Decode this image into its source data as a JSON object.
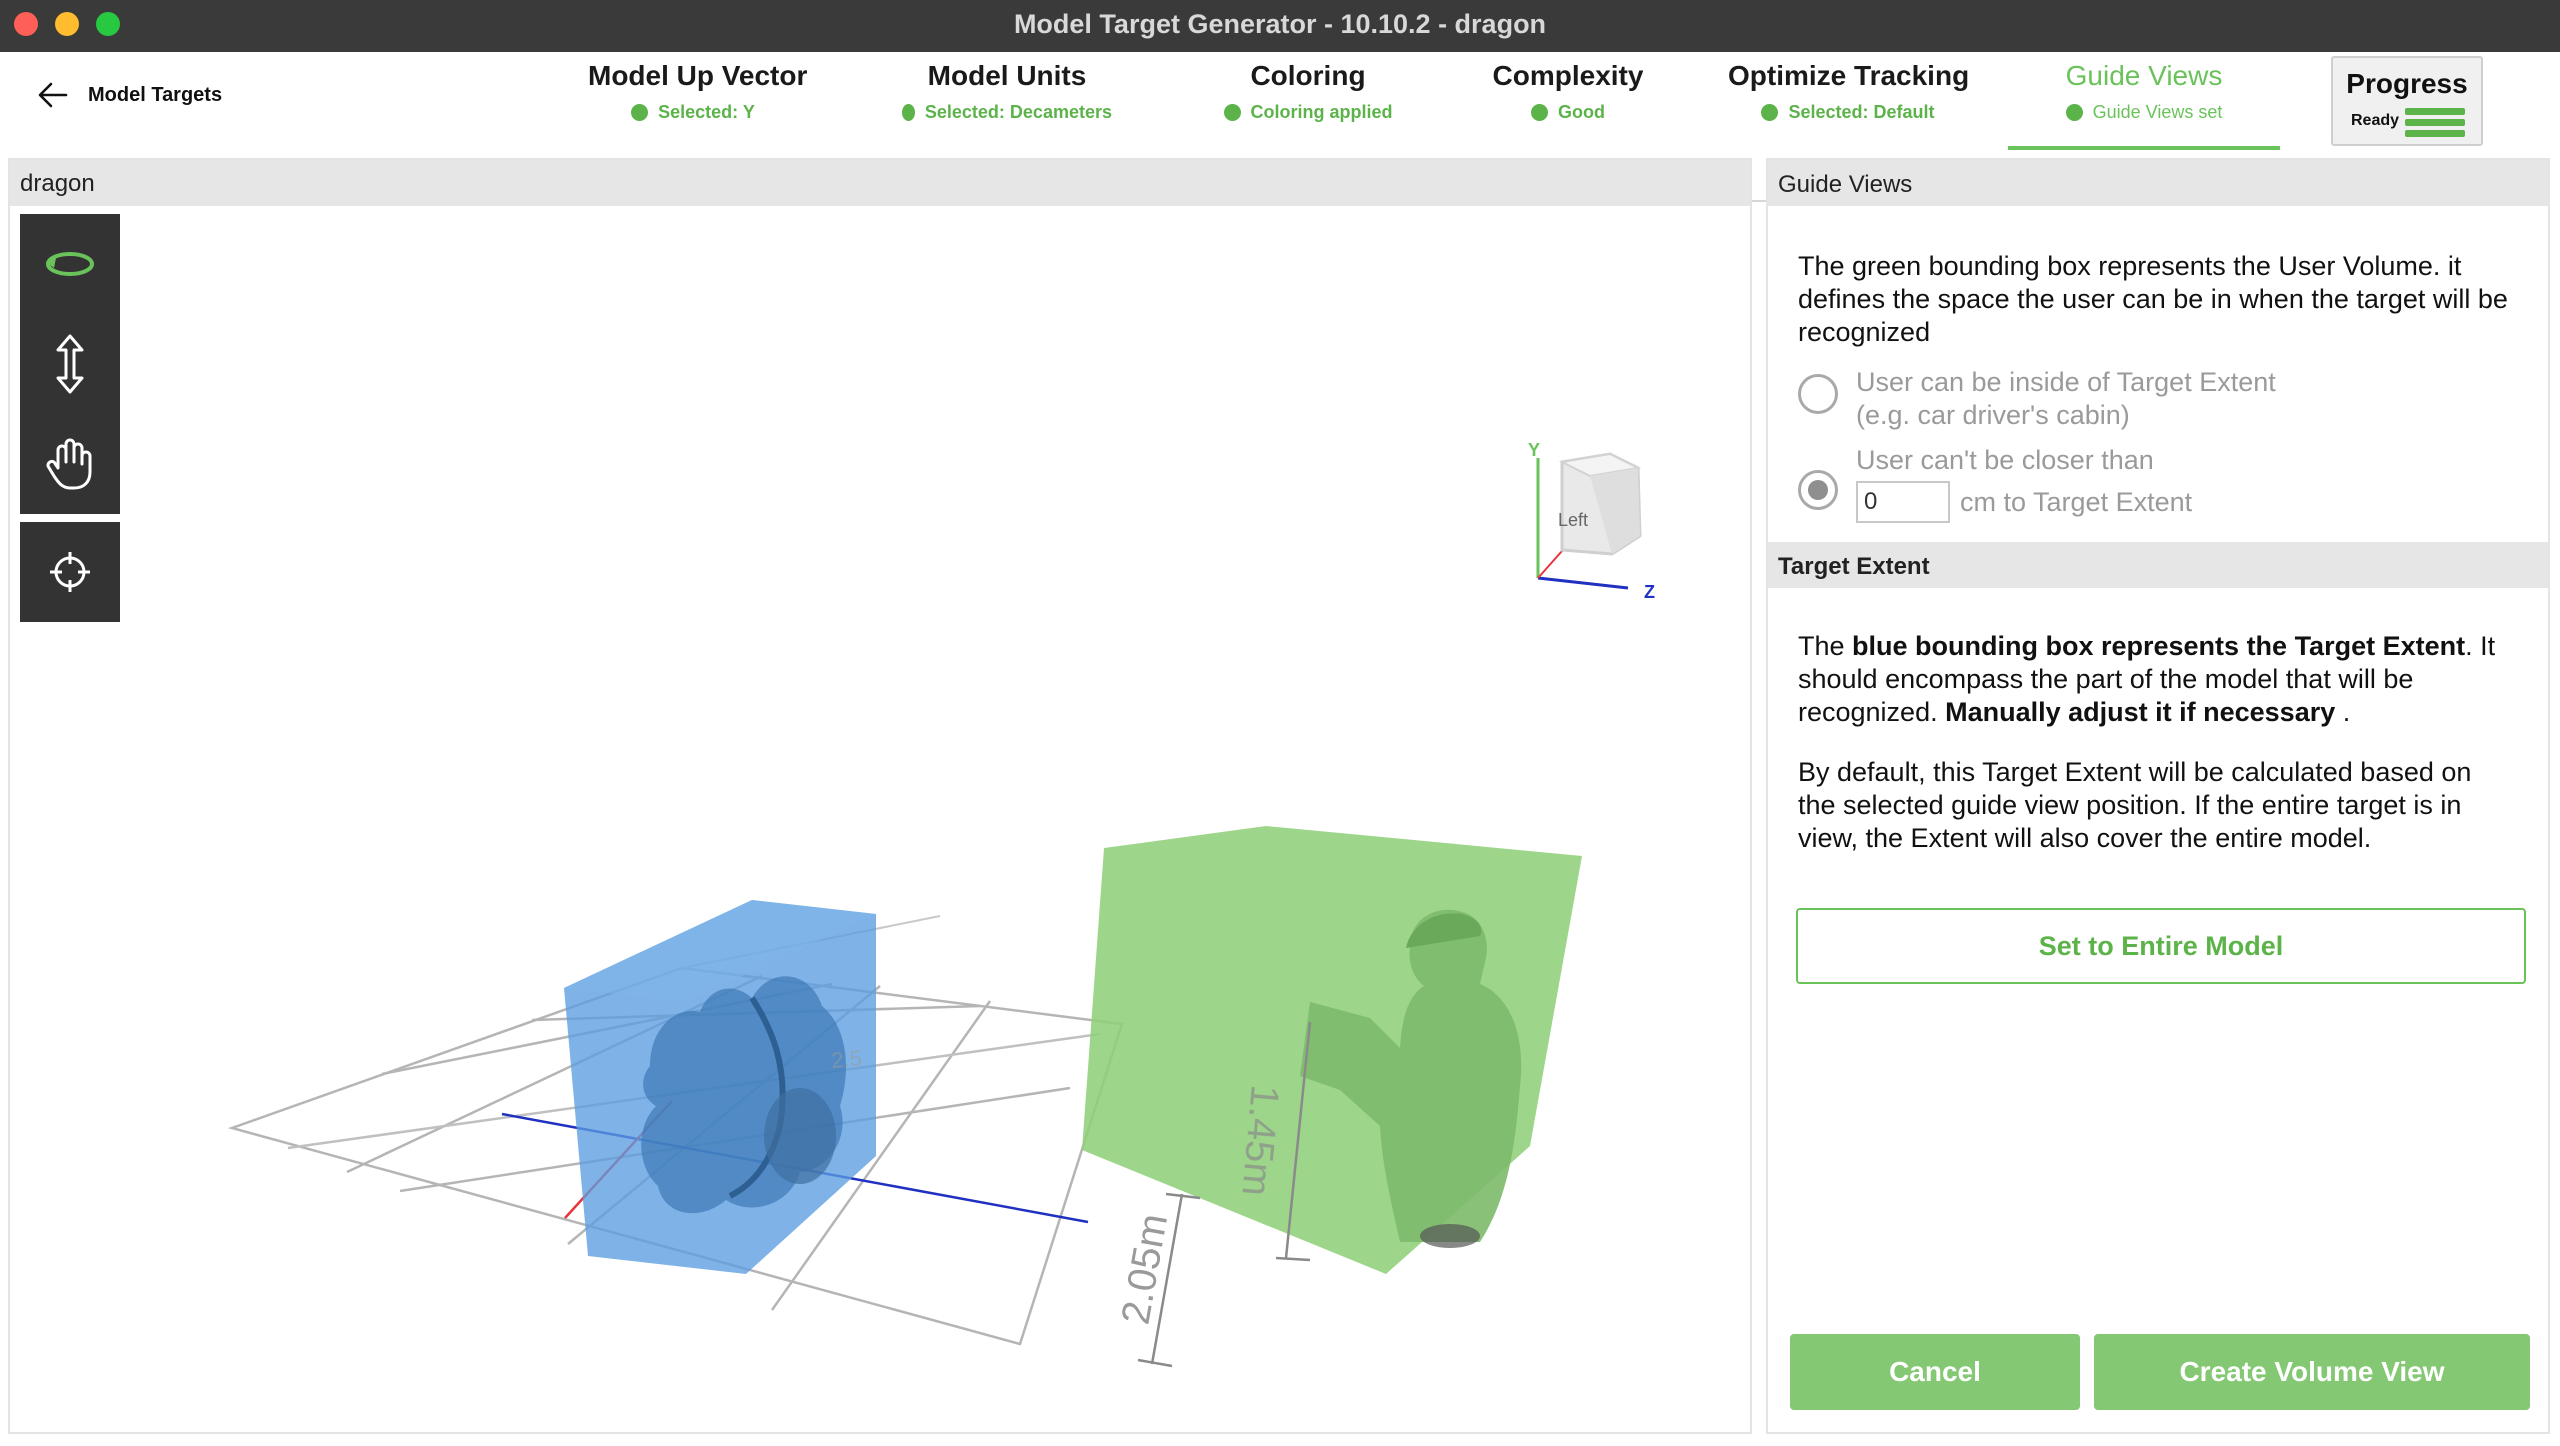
{
  "window": {
    "title": "Model Target Generator - 10.10.2 - dragon"
  },
  "nav": {
    "back_label": "Model Targets",
    "steps": [
      {
        "label": "Model Up Vector",
        "status": "Selected: Y"
      },
      {
        "label": "Model Units",
        "status": "Selected: Decameters"
      },
      {
        "label": "Coloring",
        "status": "Coloring applied"
      },
      {
        "label": "Complexity",
        "status": "Good"
      },
      {
        "label": "Optimize Tracking",
        "status": "Selected: Default"
      },
      {
        "label": "Guide Views",
        "status": "Guide Views set",
        "active": true
      }
    ],
    "progress": {
      "title": "Progress",
      "status": "Ready",
      "level": 1.0
    }
  },
  "viewport": {
    "model_name": "dragon",
    "tools": [
      "rotate-icon",
      "vertical-move-icon",
      "pan-hand-icon",
      "target-center-icon"
    ],
    "scene": {
      "orientation_cube_face": "Left",
      "axis_labels": [
        "Y",
        "Z"
      ],
      "dimension_labels": [
        "2.05m",
        "1.45m",
        "2.5"
      ]
    }
  },
  "panel": {
    "guide_views": {
      "header": "Guide Views",
      "description": "The green bounding box represents the User Volume. it defines the space the user can be in when the target will be recognized",
      "option_inside": {
        "line1": "User can be inside of Target Extent",
        "line2": "(e.g. car driver's cabin)",
        "selected": false
      },
      "option_closer": {
        "line1": "User can't be closer than",
        "value": "0",
        "suffix": "cm to Target Extent",
        "selected": true
      }
    },
    "target_extent": {
      "header": "Target Extent",
      "p1_a": "The ",
      "p1_b": "blue bounding box represents the Target Extent",
      "p1_c": ". It should encompass the part of the model that will be recognized. ",
      "p1_d": "Manually adjust it if necessary",
      "p1_e": " .",
      "p2": "By default, this Target Extent will be calculated based on the selected guide view position. If the entire target is in view, the Extent will also cover the entire model.",
      "set_entire_label": "Set to Entire Model"
    },
    "cancel_label": "Cancel",
    "create_label": "Create Volume View"
  },
  "colors": {
    "accent_green": "#5cb34a",
    "button_green": "#84c873",
    "user_volume": "#8fd07a",
    "target_extent": "#5b9ee0",
    "titlebar": "#3a3a3a"
  }
}
